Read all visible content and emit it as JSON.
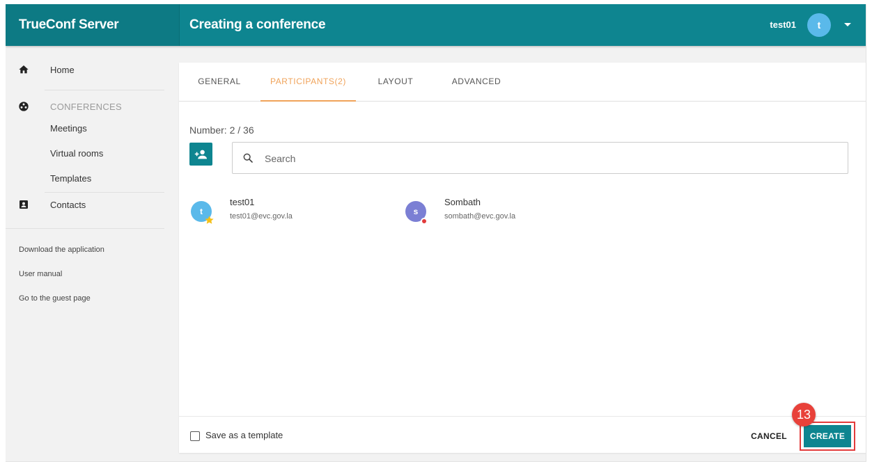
{
  "header": {
    "brand": "TrueConf Server",
    "page_title": "Creating a conference",
    "user_name": "test01",
    "user_avatar_letter": "t"
  },
  "sidebar": {
    "home": "Home",
    "conferences_section": "CONFERENCES",
    "meetings": "Meetings",
    "virtual_rooms": "Virtual rooms",
    "templates": "Templates",
    "contacts": "Contacts",
    "links": {
      "download": "Download the application",
      "manual": "User manual",
      "guest": "Go to the guest page"
    }
  },
  "tabs": [
    {
      "label": "GENERAL",
      "active": false
    },
    {
      "label": "PARTICIPANTS(2)",
      "active": true
    },
    {
      "label": "LAYOUT",
      "active": false
    },
    {
      "label": "ADVANCED",
      "active": false
    }
  ],
  "participants_panel": {
    "count_label": "Number: 2 / 36",
    "search_placeholder": "Search",
    "list": [
      {
        "initial": "t",
        "name": "test01",
        "email": "test01@evc.gov.la",
        "avatar_color": "#5ab9ea",
        "badge": "owner-star"
      },
      {
        "initial": "s",
        "name": "Sombath",
        "email": "sombath@evc.gov.la",
        "avatar_color": "#7b7fd4",
        "badge": "status-busy"
      }
    ]
  },
  "footer": {
    "save_template_label": "Save as a template",
    "cancel_label": "CANCEL",
    "create_label": "CREATE"
  },
  "annotation": {
    "step_number": "13"
  },
  "colors": {
    "primary": "#0e8590",
    "accent": "#f0a35a",
    "highlight": "#e23b3b"
  }
}
